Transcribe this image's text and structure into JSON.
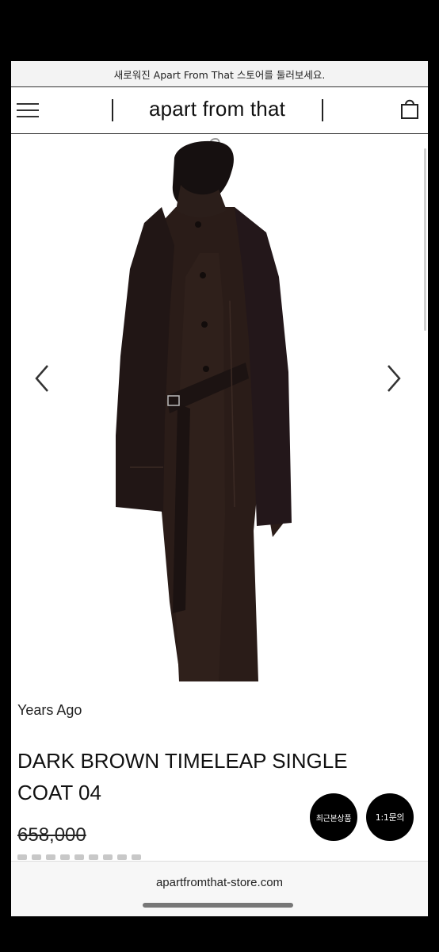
{
  "banner": {
    "text": "새로워진 Apart From That 스토어를 둘러보세요."
  },
  "header": {
    "brand": "apart from that",
    "menu_icon": "hamburger-menu-icon",
    "cart_icon": "shopping-bag-icon"
  },
  "gallery": {
    "image_subject": "dark-brown-coat-photo",
    "prev_icon": "chevron-left-icon",
    "next_icon": "chevron-right-icon"
  },
  "product": {
    "brand": "Years Ago",
    "title": "DARK BROWN TIMELEAP SINGLE COAT 04",
    "price_original": "658,000"
  },
  "floating": {
    "recent_label": "최근본상품",
    "inquiry_label": "1:1문의"
  },
  "browser": {
    "url": "apartfromthat-store.com"
  },
  "colors": {
    "coat": "#2a1c18",
    "floating_button": "#000000",
    "background": "#ffffff"
  }
}
